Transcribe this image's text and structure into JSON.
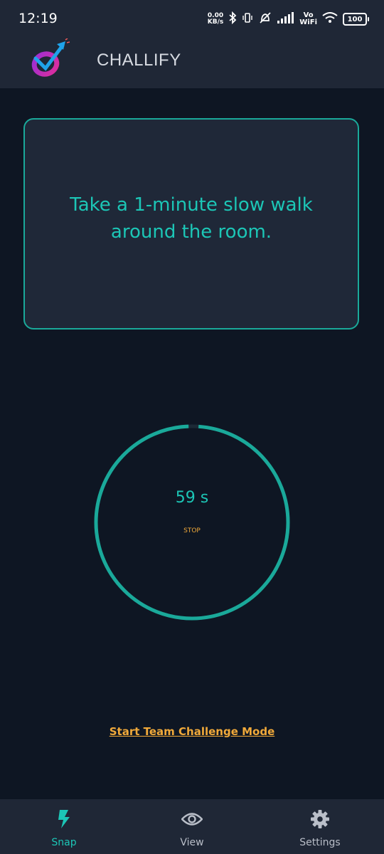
{
  "status_bar": {
    "time": "12:19",
    "net_speed_value": "0.00",
    "net_speed_unit": "KB/s",
    "vo_label": "Vo",
    "wifi_label": "WiFi",
    "battery": "100"
  },
  "app_bar": {
    "title": "CHALLIFY"
  },
  "challenge": {
    "text": "Take a 1-minute slow walk around the room."
  },
  "timer": {
    "remaining_label": "59 s",
    "stop_label": "STOP",
    "progress_fraction": 0.983,
    "ring_color": "#1aa99a"
  },
  "team_mode": {
    "link_label": "Start Team Challenge Mode"
  },
  "bottom_nav": {
    "items": [
      {
        "label": "Snap",
        "icon": "lightning-icon",
        "active": true
      },
      {
        "label": "View",
        "icon": "eye-icon",
        "active": false
      },
      {
        "label": "Settings",
        "icon": "gear-icon",
        "active": false
      }
    ]
  },
  "colors": {
    "accent": "#1cc6b6",
    "link": "#f0a93a",
    "background": "#0e1623",
    "bar": "#1f2736"
  }
}
